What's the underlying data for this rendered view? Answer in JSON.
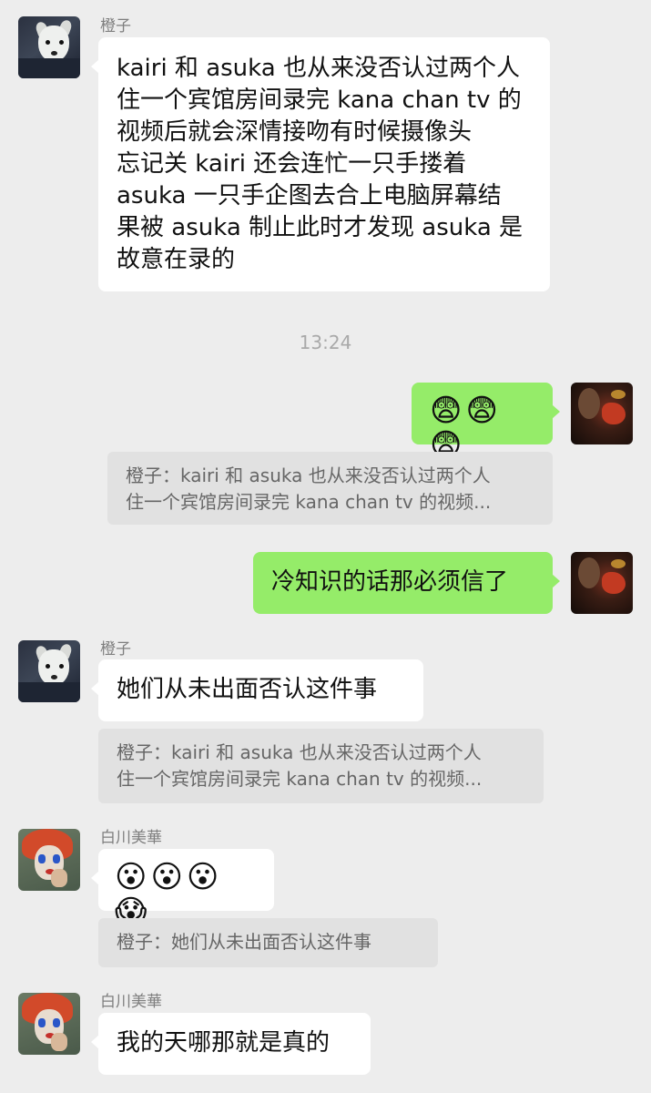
{
  "messages": [
    {
      "sender": "橙子",
      "text_lines": [
        "kairi 和 asuka 也从来没否认过两个人",
        "住一个宾馆房间录完 kana chan tv 的",
        "视频后就会深情接吻有时候摄像头",
        "忘记关 kairi 还会连忙一只手搂着",
        "asuka 一只手企图去合上电脑屏幕结",
        "果被 asuka 制止此时才发现 asuka 是",
        "故意在录的"
      ]
    },
    {
      "text": "😨😨😨",
      "quote_lines": [
        "橙子：kairi 和 asuka 也从来没否认过两个人",
        "住一个宾馆房间录完 kana chan tv 的视频..."
      ]
    },
    {
      "text": "冷知识的话那必须信了"
    },
    {
      "sender": "橙子",
      "text": "她们从未出面否认这件事",
      "quote_lines": [
        "橙子：kairi 和 asuka 也从来没否认过两个人",
        "住一个宾馆房间录完 kana chan tv 的视频..."
      ]
    },
    {
      "sender": "白川美華",
      "text": "😮😮😮😱",
      "quote_lines": [
        "橙子：她们从未出面否认这件事"
      ]
    },
    {
      "sender": "白川美華",
      "text": "我的天哪那就是真的"
    }
  ],
  "timestamp": "13:24"
}
